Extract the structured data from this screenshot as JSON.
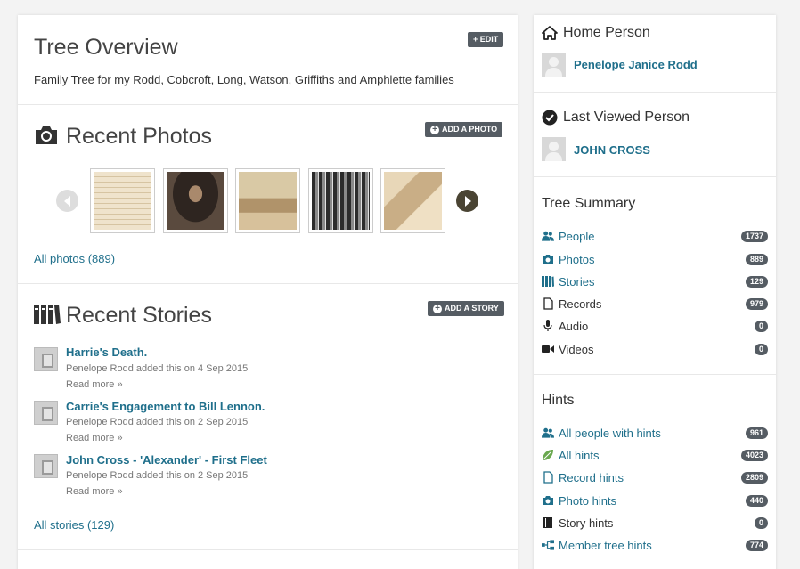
{
  "overview": {
    "title": "Tree Overview",
    "edit_label": "+ EDIT",
    "description": "Family Tree for my Rodd, Cobcroft, Long, Watson, Griffiths and Amphlette families"
  },
  "photos": {
    "title": "Recent Photos",
    "add_label": "ADD A PHOTO",
    "all_link": "All photos (889)"
  },
  "stories": {
    "title": "Recent Stories",
    "add_label": "ADD A STORY",
    "items": [
      {
        "title": "Harrie's Death.",
        "meta": "Penelope Rodd added this on 4 Sep 2015",
        "more": "Read more »"
      },
      {
        "title": "Carrie's Engagement to Bill Lennon.",
        "meta": "Penelope Rodd added this on 2 Sep 2015",
        "more": "Read more »"
      },
      {
        "title": "John Cross - 'Alexander' - First Fleet",
        "meta": "Penelope Rodd added this on 2 Sep 2015",
        "more": "Read more »"
      }
    ],
    "all_link": "All stories (129)"
  },
  "home_person": {
    "title": "Home Person",
    "name": "Penelope Janice Rodd"
  },
  "last_viewed": {
    "title": "Last Viewed Person",
    "name": "JOHN CROSS"
  },
  "summary": {
    "title": "Tree Summary",
    "rows": [
      {
        "label": "People",
        "count": "1737",
        "icon": "people-icon"
      },
      {
        "label": "Photos",
        "count": "889",
        "icon": "camera-icon"
      },
      {
        "label": "Stories",
        "count": "129",
        "icon": "books-icon"
      },
      {
        "label": "Records",
        "count": "979",
        "icon": "document-icon"
      },
      {
        "label": "Audio",
        "count": "0",
        "icon": "microphone-icon"
      },
      {
        "label": "Videos",
        "count": "0",
        "icon": "video-icon"
      }
    ]
  },
  "hints": {
    "title": "Hints",
    "rows": [
      {
        "label": "All people with hints",
        "count": "961",
        "icon": "people-icon"
      },
      {
        "label": "All hints",
        "count": "4023",
        "icon": "leaf-icon"
      },
      {
        "label": "Record hints",
        "count": "2809",
        "icon": "document-icon"
      },
      {
        "label": "Photo hints",
        "count": "440",
        "icon": "camera-icon"
      },
      {
        "label": "Story hints",
        "count": "0",
        "icon": "book-icon"
      },
      {
        "label": "Member tree hints",
        "count": "774",
        "icon": "tree-icon"
      }
    ]
  },
  "colors": {
    "link": "#1f6f8b",
    "badge": "#555c63",
    "leaf": "#6aa84f"
  }
}
